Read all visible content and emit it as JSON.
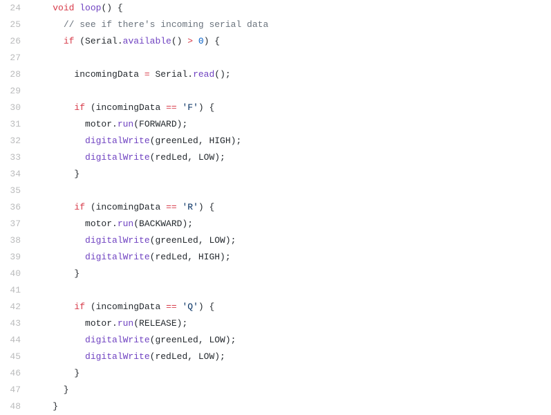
{
  "lines": [
    {
      "num": "24",
      "tokens": [
        {
          "t": "    ",
          "c": ""
        },
        {
          "t": "void",
          "c": "kw"
        },
        {
          "t": " ",
          "c": ""
        },
        {
          "t": "loop",
          "c": "fn"
        },
        {
          "t": "() {",
          "c": ""
        }
      ]
    },
    {
      "num": "25",
      "tokens": [
        {
          "t": "      ",
          "c": ""
        },
        {
          "t": "// see if there's incoming serial data",
          "c": "cm"
        }
      ]
    },
    {
      "num": "26",
      "tokens": [
        {
          "t": "      ",
          "c": ""
        },
        {
          "t": "if",
          "c": "kw"
        },
        {
          "t": " (Serial.",
          "c": ""
        },
        {
          "t": "available",
          "c": "fn"
        },
        {
          "t": "() ",
          "c": ""
        },
        {
          "t": ">",
          "c": "kw"
        },
        {
          "t": " ",
          "c": ""
        },
        {
          "t": "0",
          "c": "num"
        },
        {
          "t": ") {",
          "c": ""
        }
      ]
    },
    {
      "num": "27",
      "tokens": [
        {
          "t": "",
          "c": ""
        }
      ]
    },
    {
      "num": "28",
      "tokens": [
        {
          "t": "        incomingData ",
          "c": ""
        },
        {
          "t": "=",
          "c": "kw"
        },
        {
          "t": " Serial.",
          "c": ""
        },
        {
          "t": "read",
          "c": "fn"
        },
        {
          "t": "();",
          "c": ""
        }
      ]
    },
    {
      "num": "29",
      "tokens": [
        {
          "t": "",
          "c": ""
        }
      ]
    },
    {
      "num": "30",
      "tokens": [
        {
          "t": "        ",
          "c": ""
        },
        {
          "t": "if",
          "c": "kw"
        },
        {
          "t": " (incomingData ",
          "c": ""
        },
        {
          "t": "==",
          "c": "kw"
        },
        {
          "t": " ",
          "c": ""
        },
        {
          "t": "'F'",
          "c": "str"
        },
        {
          "t": ") {",
          "c": ""
        }
      ]
    },
    {
      "num": "31",
      "tokens": [
        {
          "t": "          motor.",
          "c": ""
        },
        {
          "t": "run",
          "c": "fn"
        },
        {
          "t": "(FORWARD);",
          "c": ""
        }
      ]
    },
    {
      "num": "32",
      "tokens": [
        {
          "t": "          ",
          "c": ""
        },
        {
          "t": "digitalWrite",
          "c": "fn"
        },
        {
          "t": "(greenLed, HIGH);",
          "c": ""
        }
      ]
    },
    {
      "num": "33",
      "tokens": [
        {
          "t": "          ",
          "c": ""
        },
        {
          "t": "digitalWrite",
          "c": "fn"
        },
        {
          "t": "(redLed, LOW);",
          "c": ""
        }
      ]
    },
    {
      "num": "34",
      "tokens": [
        {
          "t": "        }",
          "c": ""
        }
      ]
    },
    {
      "num": "35",
      "tokens": [
        {
          "t": "",
          "c": ""
        }
      ]
    },
    {
      "num": "36",
      "tokens": [
        {
          "t": "        ",
          "c": ""
        },
        {
          "t": "if",
          "c": "kw"
        },
        {
          "t": " (incomingData ",
          "c": ""
        },
        {
          "t": "==",
          "c": "kw"
        },
        {
          "t": " ",
          "c": ""
        },
        {
          "t": "'R'",
          "c": "str"
        },
        {
          "t": ") {",
          "c": ""
        }
      ]
    },
    {
      "num": "37",
      "tokens": [
        {
          "t": "          motor.",
          "c": ""
        },
        {
          "t": "run",
          "c": "fn"
        },
        {
          "t": "(BACKWARD);",
          "c": ""
        }
      ]
    },
    {
      "num": "38",
      "tokens": [
        {
          "t": "          ",
          "c": ""
        },
        {
          "t": "digitalWrite",
          "c": "fn"
        },
        {
          "t": "(greenLed, LOW);",
          "c": ""
        }
      ]
    },
    {
      "num": "39",
      "tokens": [
        {
          "t": "          ",
          "c": ""
        },
        {
          "t": "digitalWrite",
          "c": "fn"
        },
        {
          "t": "(redLed, HIGH);",
          "c": ""
        }
      ]
    },
    {
      "num": "40",
      "tokens": [
        {
          "t": "        }",
          "c": ""
        }
      ]
    },
    {
      "num": "41",
      "tokens": [
        {
          "t": "",
          "c": ""
        }
      ]
    },
    {
      "num": "42",
      "tokens": [
        {
          "t": "        ",
          "c": ""
        },
        {
          "t": "if",
          "c": "kw"
        },
        {
          "t": " (incomingData ",
          "c": ""
        },
        {
          "t": "==",
          "c": "kw"
        },
        {
          "t": " ",
          "c": ""
        },
        {
          "t": "'Q'",
          "c": "str"
        },
        {
          "t": ") {",
          "c": ""
        }
      ]
    },
    {
      "num": "43",
      "tokens": [
        {
          "t": "          motor.",
          "c": ""
        },
        {
          "t": "run",
          "c": "fn"
        },
        {
          "t": "(RELEASE);",
          "c": ""
        }
      ]
    },
    {
      "num": "44",
      "tokens": [
        {
          "t": "          ",
          "c": ""
        },
        {
          "t": "digitalWrite",
          "c": "fn"
        },
        {
          "t": "(greenLed, LOW);",
          "c": ""
        }
      ]
    },
    {
      "num": "45",
      "tokens": [
        {
          "t": "          ",
          "c": ""
        },
        {
          "t": "digitalWrite",
          "c": "fn"
        },
        {
          "t": "(redLed, LOW);",
          "c": ""
        }
      ]
    },
    {
      "num": "46",
      "tokens": [
        {
          "t": "        }",
          "c": ""
        }
      ]
    },
    {
      "num": "47",
      "tokens": [
        {
          "t": "      }",
          "c": ""
        }
      ]
    },
    {
      "num": "48",
      "tokens": [
        {
          "t": "    }",
          "c": ""
        }
      ]
    }
  ]
}
